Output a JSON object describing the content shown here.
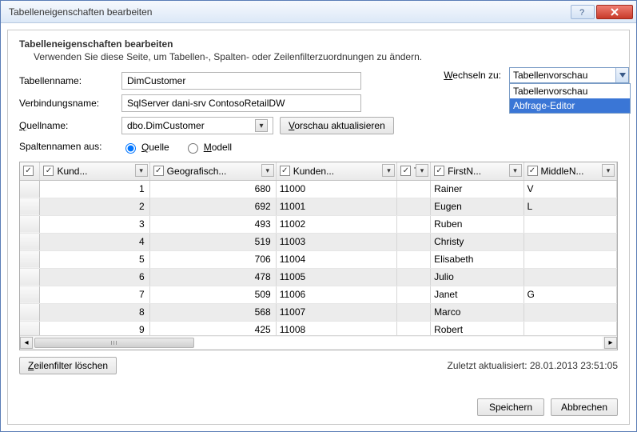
{
  "window": {
    "title": "Tabelleneigenschaften bearbeiten"
  },
  "panel": {
    "heading": "Tabelleneigenschaften bearbeiten",
    "description": "Verwenden Sie diese Seite, um Tabellen-, Spalten- oder Zeilenfilterzuordnungen zu ändern."
  },
  "form": {
    "table_name_label": "Tabellenname:",
    "table_name_value": "DimCustomer",
    "connection_label": "Verbindungsname:",
    "connection_value": "SqlServer dani-srv ContosoRetailDW",
    "source_label": "Quellname:",
    "source_value": "dbo.DimCustomer",
    "refresh_button": "Vorschau aktualisieren",
    "colnames_label": "Spaltennamen aus:",
    "option_source": "Quelle",
    "option_model": "Modell"
  },
  "switch": {
    "label": "Wechseln zu:",
    "selected": "Tabellenvorschau",
    "options": [
      "Tabellenvorschau",
      "Abfrage-Editor"
    ]
  },
  "headers": [
    "Kund...",
    "Geografisch...",
    "Kunden...",
    "T...",
    "FirstN...",
    "MiddleN..."
  ],
  "chart_data": {
    "type": "table",
    "columns": [
      "Kund...",
      "Geografisch...",
      "Kunden...",
      "T...",
      "FirstN...",
      "MiddleN..."
    ],
    "rows": [
      {
        "kund": 1,
        "geo": 680,
        "kunden": "11000",
        "t": "",
        "first": "Rainer",
        "middle": "V"
      },
      {
        "kund": 2,
        "geo": 692,
        "kunden": "11001",
        "t": "",
        "first": "Eugen",
        "middle": "L"
      },
      {
        "kund": 3,
        "geo": 493,
        "kunden": "11002",
        "t": "",
        "first": "Ruben",
        "middle": ""
      },
      {
        "kund": 4,
        "geo": 519,
        "kunden": "11003",
        "t": "",
        "first": "Christy",
        "middle": ""
      },
      {
        "kund": 5,
        "geo": 706,
        "kunden": "11004",
        "t": "",
        "first": "Elisabeth",
        "middle": ""
      },
      {
        "kund": 6,
        "geo": 478,
        "kunden": "11005",
        "t": "",
        "first": "Julio",
        "middle": ""
      },
      {
        "kund": 7,
        "geo": 509,
        "kunden": "11006",
        "t": "",
        "first": "Janet",
        "middle": "G"
      },
      {
        "kund": 8,
        "geo": 568,
        "kunden": "11007",
        "t": "",
        "first": "Marco",
        "middle": ""
      },
      {
        "kund": 9,
        "geo": 425,
        "kunden": "11008",
        "t": "",
        "first": "Robert",
        "middle": ""
      }
    ]
  },
  "footer": {
    "clear_filter": "Zeilenfilter löschen",
    "last_updated": "Zuletzt aktualisiert: 28.01.2013 23:51:05",
    "save": "Speichern",
    "cancel": "Abbrechen"
  }
}
